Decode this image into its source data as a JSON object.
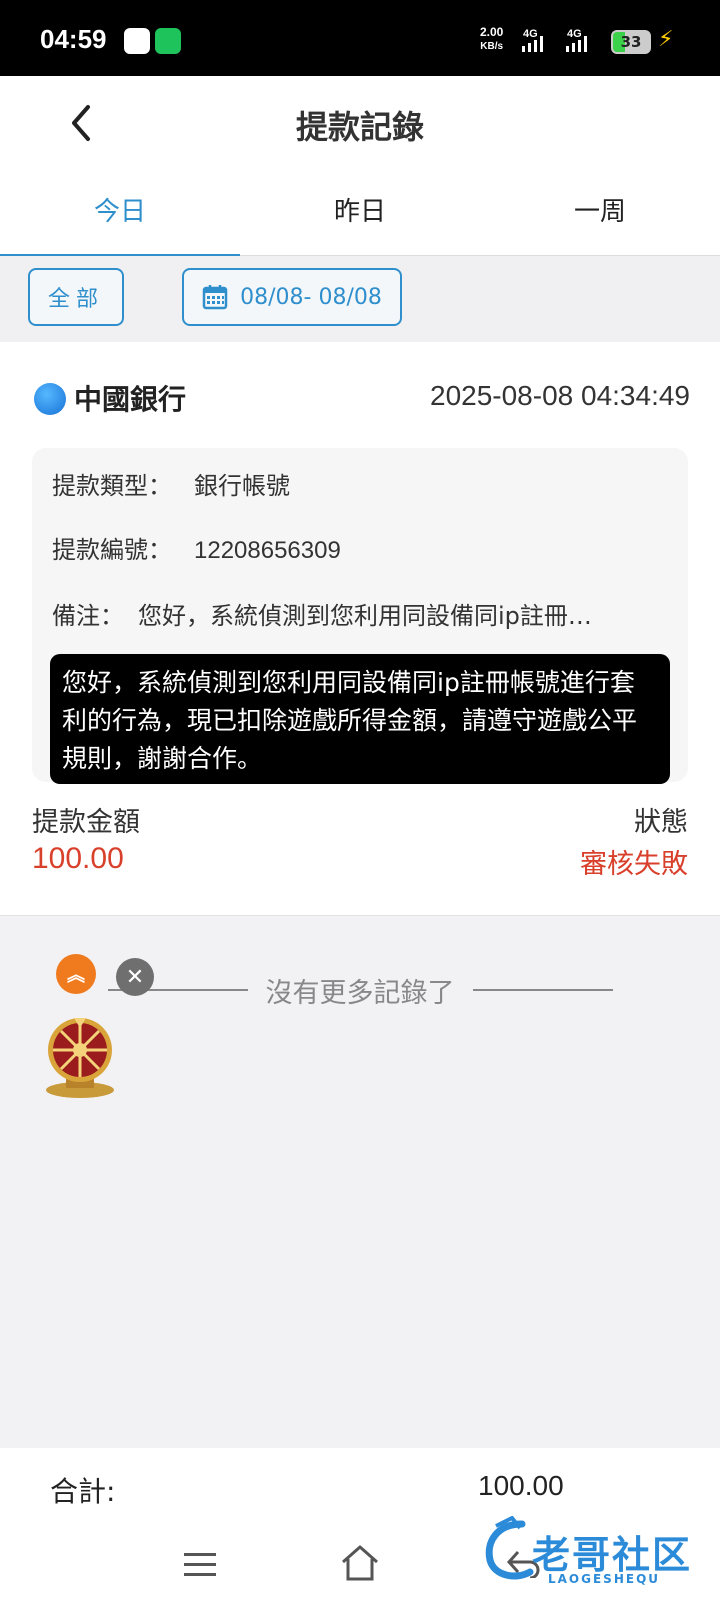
{
  "status_bar": {
    "time": "04:59",
    "speed_value": "2.00",
    "speed_unit": "KB/s",
    "net1": "4G",
    "net2": "4G",
    "battery": "33"
  },
  "header": {
    "title": "提款記錄"
  },
  "tabs": [
    {
      "label": "今日",
      "active": true
    },
    {
      "label": "昨日",
      "active": false
    },
    {
      "label": "一周",
      "active": false
    }
  ],
  "filters": {
    "all_label": "全部",
    "date_range": "08/08- 08/08"
  },
  "record": {
    "bank_name": "中國銀行",
    "datetime": "2025-08-08 04:34:49",
    "type_label": "提款類型：",
    "type_value": "銀行帳號",
    "id_label": "提款編號：",
    "id_value": "12208656309",
    "note_label": "備注：",
    "note_preview": "您好，系統偵測到您利用同設備同ip註冊…",
    "note_full": "您好，系統偵測到您利用同設備同ip註冊帳號進行套利的行為，現已扣除遊戲所得金額，請遵守遊戲公平規則，謝謝合作。",
    "amount_label": "提款金額",
    "amount_value": "100.00",
    "status_label": "狀態",
    "status_value": "審核失敗"
  },
  "list_end_text": "沒有更多記錄了",
  "footer": {
    "total_label": "合計:",
    "total_value": "100.00"
  },
  "watermark": {
    "text": "老哥社区",
    "sub": "LAOGESHEQU"
  },
  "colors": {
    "accent": "#2f8fcc",
    "danger": "#d9402b"
  }
}
